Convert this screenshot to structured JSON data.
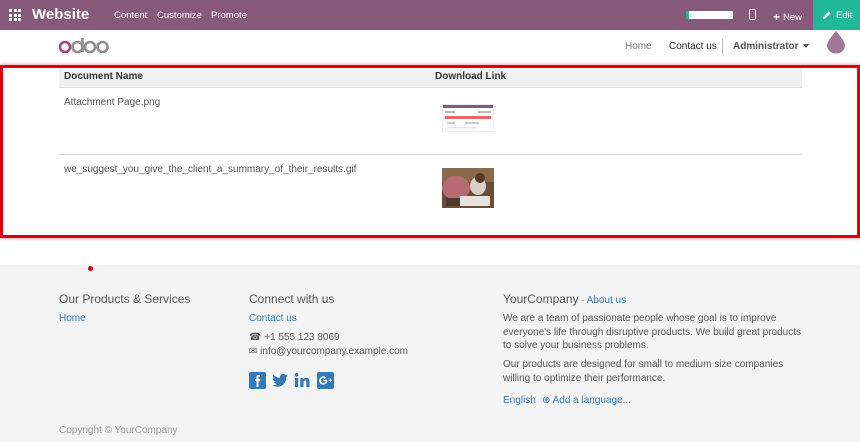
{
  "topbar": {
    "brand": "Website",
    "menu": [
      "Content",
      "Customize",
      "Promote"
    ],
    "new_label": "New",
    "edit_label": "Edit",
    "accent": "#875a7b",
    "edit_color": "#21b799"
  },
  "navbar": {
    "logo_text": "odoo",
    "links": [
      "Home",
      "Contact us"
    ],
    "active_link": "Contact us",
    "user": "Administrator"
  },
  "table": {
    "headers": [
      "Document Name",
      "Download Link"
    ],
    "rows": [
      {
        "name": "Attachment Page.png",
        "thumb": "screenshot-thumbnail"
      },
      {
        "name": "we_suggest_you_give_the_client_a_summary_of_their_results.gif",
        "thumb": "photo-thumbnail"
      }
    ]
  },
  "footer": {
    "products_heading": "Our Products & Services",
    "products_links": [
      "Home"
    ],
    "connect_heading": "Connect with us",
    "contact_link": "Contact us",
    "phone": "+1 555 123 8069",
    "email": "info@yourcompany.example.com",
    "social_icons": [
      "facebook-icon",
      "twitter-icon",
      "linkedin-icon",
      "google-plus-icon"
    ],
    "company_heading": "YourCompany",
    "about_link": "About us",
    "about_sep": " - ",
    "para1": "We are a team of passionate people whose goal is to improve everyone's life through disruptive products. We build great products to solve your business problems.",
    "para2": "Our products are designed for small to medium size companies willing to optimize their performance.",
    "language": "English",
    "add_language": "Add a language...",
    "copyright": "Copyright © YourCompany"
  }
}
